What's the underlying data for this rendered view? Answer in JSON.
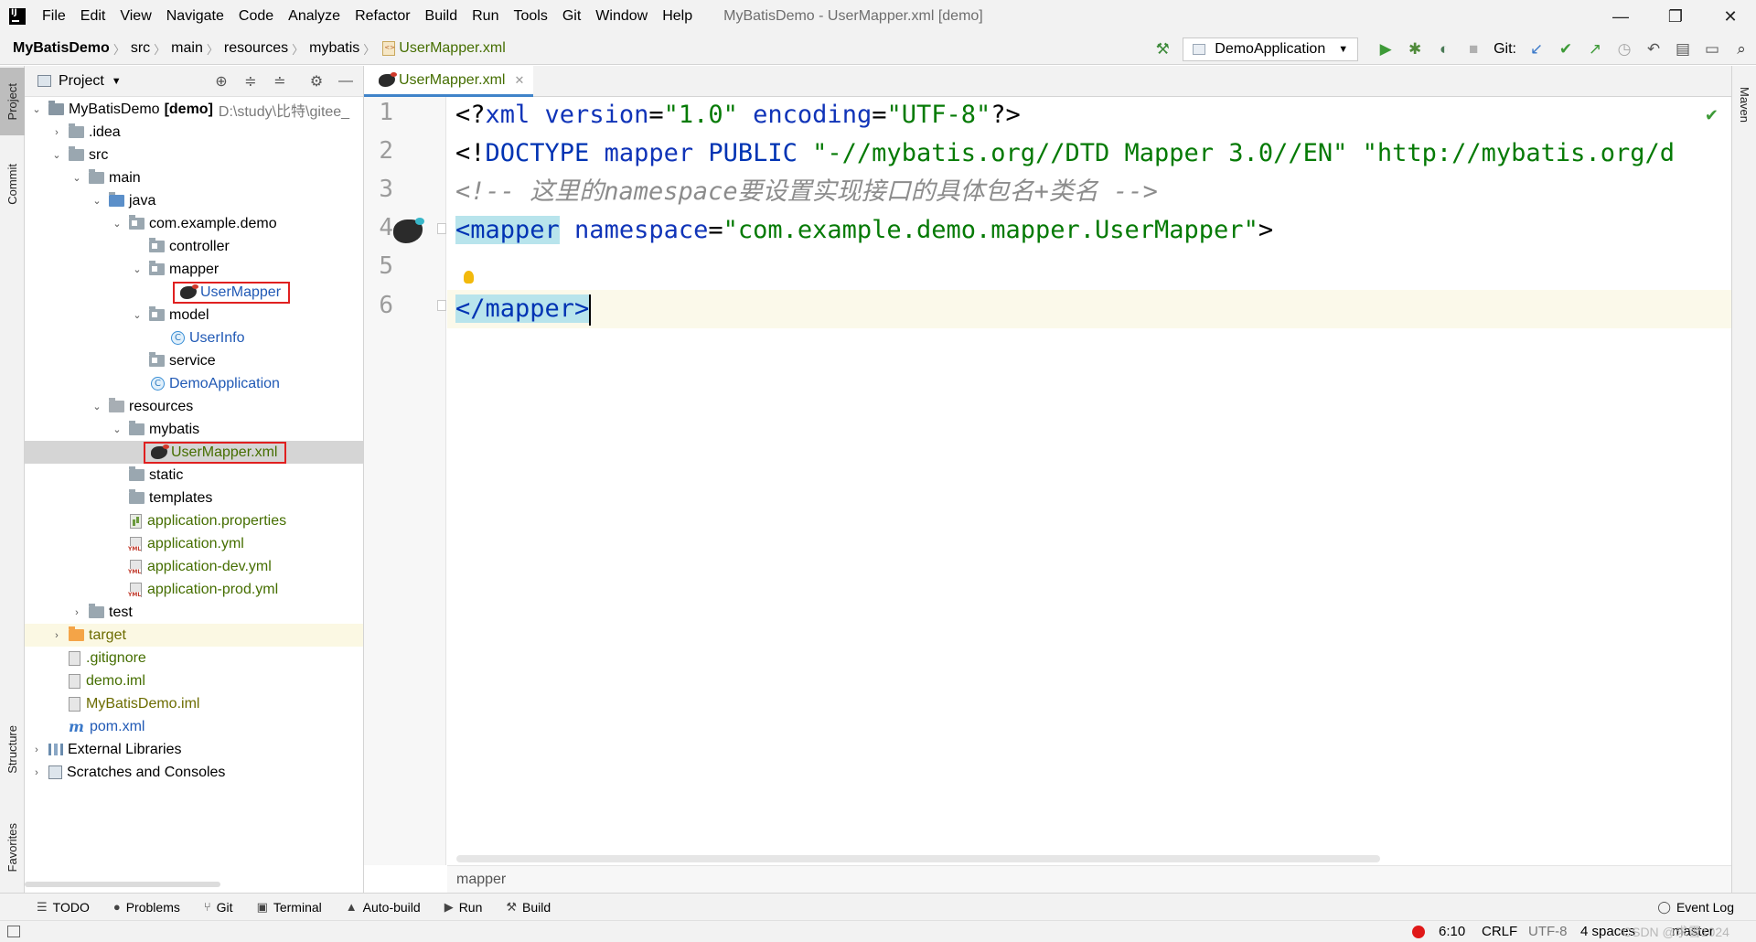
{
  "window": {
    "title": "MyBatisDemo - UserMapper.xml [demo]",
    "menu": [
      "File",
      "Edit",
      "View",
      "Navigate",
      "Code",
      "Analyze",
      "Refactor",
      "Build",
      "Run",
      "Tools",
      "Git",
      "Window",
      "Help"
    ],
    "controls": [
      "—",
      "❐",
      "✕"
    ]
  },
  "navbar": {
    "breadcrumbs": [
      "MyBatisDemo",
      "src",
      "main",
      "resources",
      "mybatis",
      "UserMapper.xml"
    ],
    "run_config": "DemoApplication",
    "git_label": "Git:"
  },
  "left_stripe": {
    "project": "Project",
    "commit": "Commit",
    "structure": "Structure",
    "favorites": "Favorites"
  },
  "right_stripe": {
    "maven": "Maven"
  },
  "project_panel": {
    "title": "Project",
    "root_name": "MyBatisDemo",
    "root_module": "[demo]",
    "root_path": "D:\\study\\比特\\gitee_",
    "tree": [
      {
        "label": "MyBatisDemo",
        "depth": 0
      },
      {
        "label": ".idea",
        "depth": 1
      },
      {
        "label": "src",
        "depth": 1
      },
      {
        "label": "main",
        "depth": 2
      },
      {
        "label": "java",
        "depth": 3
      },
      {
        "label": "com.example.demo",
        "depth": 4
      },
      {
        "label": "controller",
        "depth": 5
      },
      {
        "label": "mapper",
        "depth": 5
      },
      {
        "label": "UserMapper",
        "depth": 6
      },
      {
        "label": "model",
        "depth": 5
      },
      {
        "label": "UserInfo",
        "depth": 6
      },
      {
        "label": "service",
        "depth": 5
      },
      {
        "label": "DemoApplication",
        "depth": 5
      },
      {
        "label": "resources",
        "depth": 3
      },
      {
        "label": "mybatis",
        "depth": 4
      },
      {
        "label": "UserMapper.xml",
        "depth": 5
      },
      {
        "label": "static",
        "depth": 4
      },
      {
        "label": "templates",
        "depth": 4
      },
      {
        "label": "application.properties",
        "depth": 4
      },
      {
        "label": "application.yml",
        "depth": 4
      },
      {
        "label": "application-dev.yml",
        "depth": 4
      },
      {
        "label": "application-prod.yml",
        "depth": 4
      },
      {
        "label": "test",
        "depth": 2
      },
      {
        "label": "target",
        "depth": 1
      },
      {
        "label": ".gitignore",
        "depth": 1
      },
      {
        "label": "demo.iml",
        "depth": 1
      },
      {
        "label": "MyBatisDemo.iml",
        "depth": 1
      },
      {
        "label": "pom.xml",
        "depth": 1
      },
      {
        "label": "External Libraries",
        "depth": 0
      },
      {
        "label": "Scratches and Consoles",
        "depth": 0
      }
    ]
  },
  "editor": {
    "tab_label": "UserMapper.xml",
    "line_numbers": [
      "1",
      "2",
      "3",
      "4",
      "5",
      "6"
    ],
    "line1": {
      "p1": "<?",
      "p2": "xml ",
      "p3": "version",
      "p4": "=",
      "p5": "\"1.0\" ",
      "p6": "encoding",
      "p7": "=",
      "p8": "\"UTF-8\"",
      "p9": "?>"
    },
    "line2": {
      "p1": "<!",
      "p2": "DOCTYPE ",
      "p3": "mapper ",
      "p4": "PUBLIC ",
      "p5": "\"-//mybatis.org//DTD Mapper 3.0//EN\" ",
      "p6": "\"http://mybatis.org/d"
    },
    "line3": "<!-- 这里的namespace要设置实现接口的具体包名+类名 -->",
    "line4": {
      "open": "<mapper",
      "attr": " namespace",
      "eq": "=",
      "val": "\"com.example.demo.mapper.UserMapper\"",
      "close": ">"
    },
    "line6": {
      "open": "</mapper",
      "close": ">"
    },
    "breadcrumb": "mapper"
  },
  "bottom_tools": [
    "TODO",
    "Problems",
    "Git",
    "Terminal",
    "Auto-build",
    "Run",
    "Build"
  ],
  "event_log": "Event Log",
  "status": {
    "position": "6:10",
    "line_sep": "CRLF",
    "encoding": "UTF-8",
    "indent": "4 spaces",
    "branch": "master",
    "watermark": "CSDN @求雪1024"
  },
  "colors": {
    "accent": "#4083c9",
    "file_green": "#456e00",
    "highlight_box": "#e02020",
    "tag_background": "#b8e4ec"
  }
}
